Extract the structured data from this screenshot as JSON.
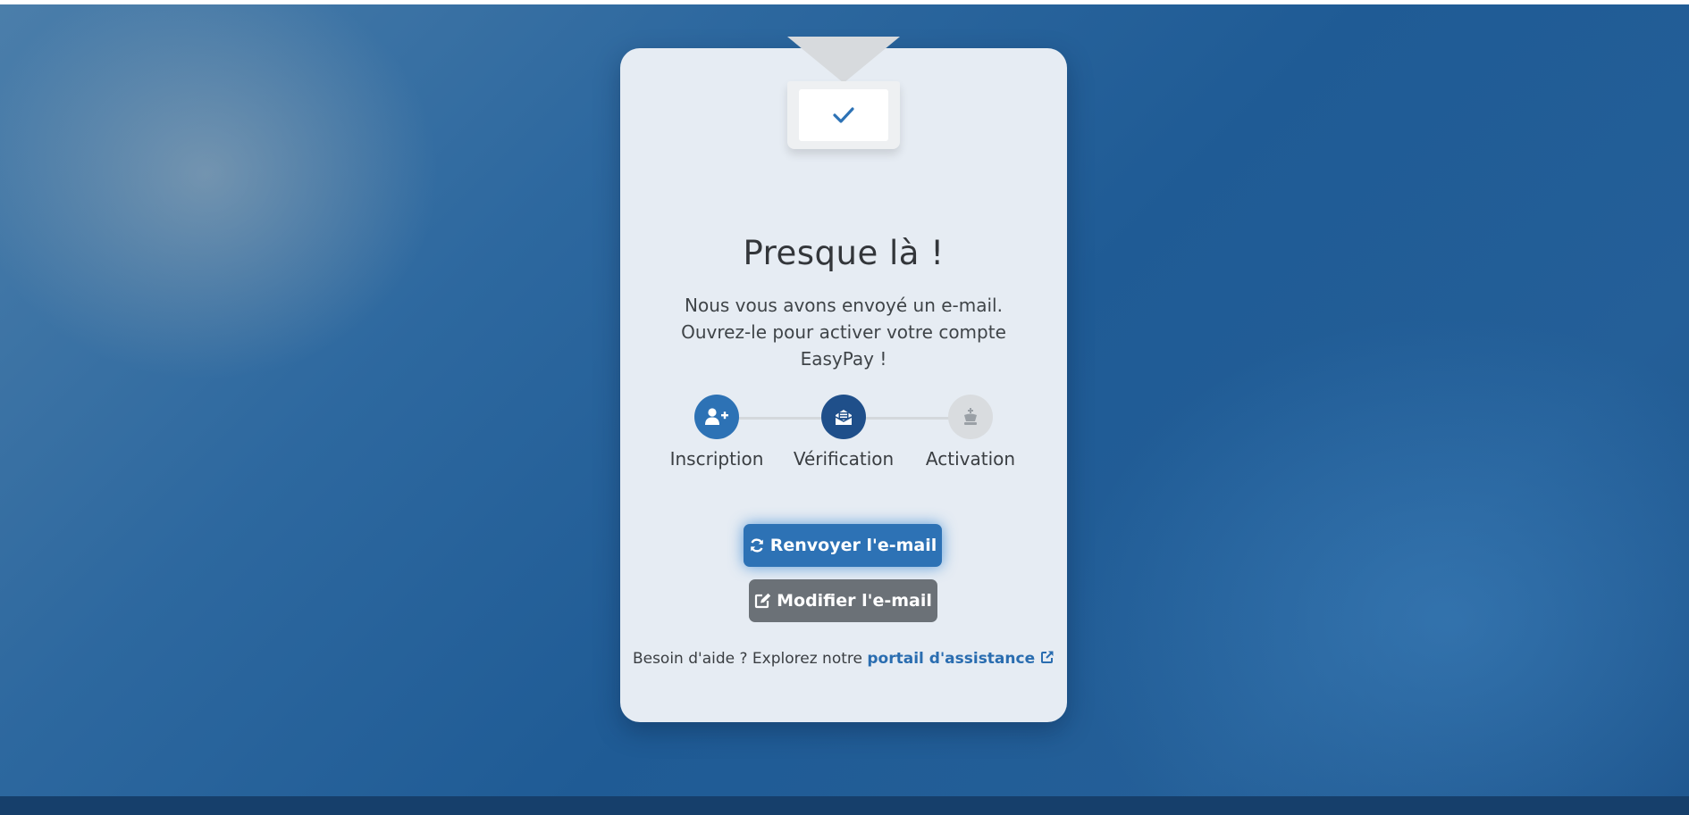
{
  "card": {
    "title": "Presque là !",
    "subtitle": "Nous vous avons envoyé un e-mail. Ouvrez-le pour activer votre compte EasyPay !"
  },
  "steps": [
    {
      "label": "Inscription",
      "icon": "user-plus-icon",
      "state": "completed",
      "color": "#2d72b5"
    },
    {
      "label": "Vérification",
      "icon": "envelope-open-icon",
      "state": "current",
      "color": "#1f4f8a"
    },
    {
      "label": "Activation",
      "icon": "chess-king-icon",
      "state": "pending",
      "color": "#d9dcdf"
    }
  ],
  "buttons": {
    "resend_label": "Renvoyer l'e-mail",
    "resend_icon": "refresh-icon",
    "modify_label": "Modifier l'e-mail",
    "modify_icon": "edit-icon"
  },
  "help": {
    "text": "Besoin d'aide ? Explorez notre",
    "link_label": "portail d'assistance",
    "link_icon": "external-link-icon"
  },
  "colors": {
    "accent": "#2d72b5",
    "secondary_button": "#6b7177",
    "card_background": "#e6ecf3"
  }
}
